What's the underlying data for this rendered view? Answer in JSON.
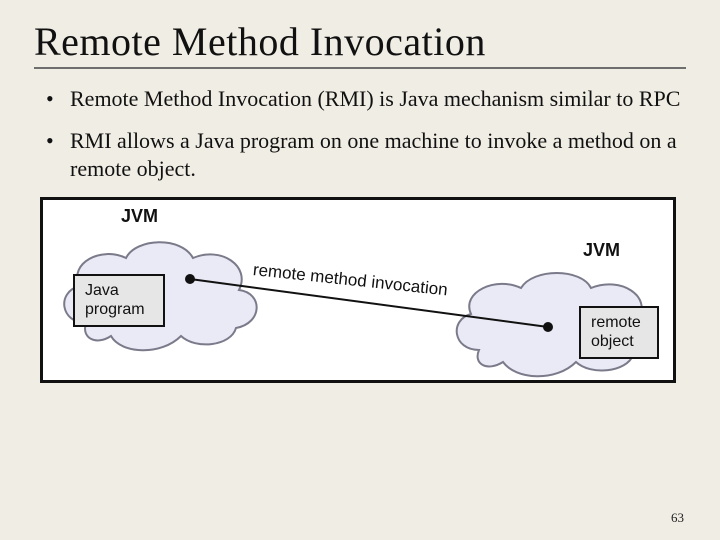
{
  "title": "Remote Method Invocation",
  "bullets": [
    "Remote Method Invocation (RMI) is Java mechanism similar to RPC",
    "RMI allows a Java program on one machine to invoke a method on a remote object."
  ],
  "diagram": {
    "jvm_left": "JVM",
    "jvm_right": "JVM",
    "box_left_line1": "Java",
    "box_left_line2": "program",
    "box_right_line1": "remote",
    "box_right_line2": "object",
    "arc_label": "remote method invocation"
  },
  "page_number": "63"
}
